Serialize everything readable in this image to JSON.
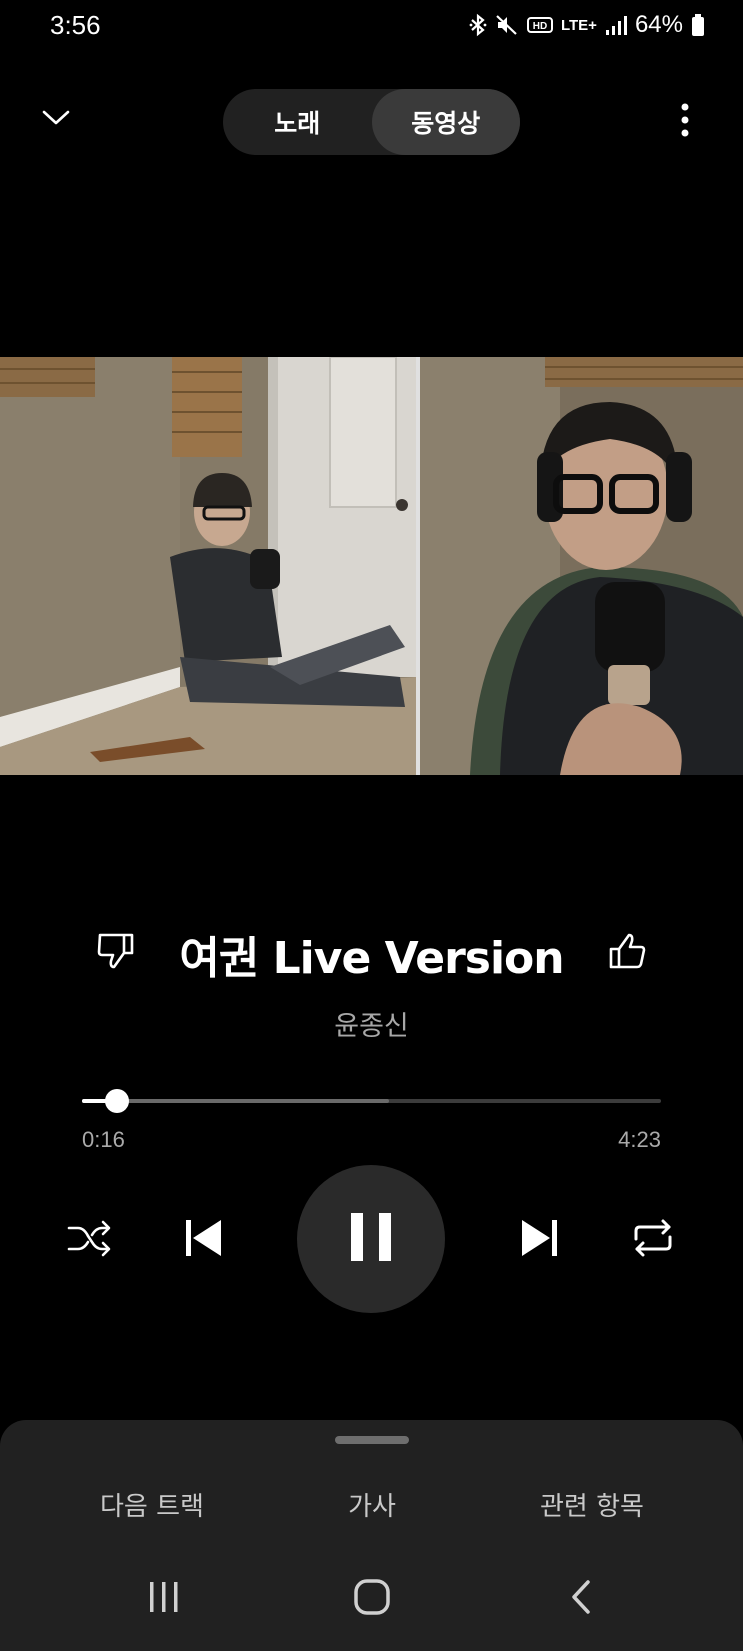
{
  "status_bar": {
    "time": "3:56",
    "network": "LTE+",
    "battery": "64%",
    "icons": [
      "bluetooth-icon",
      "mute-icon",
      "hd-voice-icon",
      "lte-icon",
      "signal-icon",
      "battery-icon"
    ]
  },
  "header": {
    "tabs": [
      {
        "label": "노래",
        "active": false
      },
      {
        "label": "동영상",
        "active": true
      }
    ],
    "collapse_icon": "chevron-down-icon",
    "menu_icon": "more-vertical-icon"
  },
  "track": {
    "title": "여권 Live Version",
    "artist": "윤종신",
    "dislike_icon": "thumbs-down-icon",
    "like_icon": "thumbs-up-icon"
  },
  "playback": {
    "current_time": "0:16",
    "total_time": "4:23",
    "progress_fraction": 0.061,
    "buffered_fraction": 0.53,
    "state": "playing",
    "controls": [
      "shuffle-icon",
      "previous-icon",
      "pause-icon",
      "next-icon",
      "repeat-icon"
    ]
  },
  "bottom_sheet": {
    "tabs": [
      "다음 트랙",
      "가사",
      "관련 항목"
    ]
  },
  "nav_bar": {
    "buttons": [
      "recents-icon",
      "home-icon",
      "back-icon"
    ]
  },
  "colors": {
    "background": "#000000",
    "sheet": "#212121",
    "toggle_bg": "#212121",
    "toggle_active": "#3a3a3a",
    "secondary_text": "#a8a8a8"
  }
}
